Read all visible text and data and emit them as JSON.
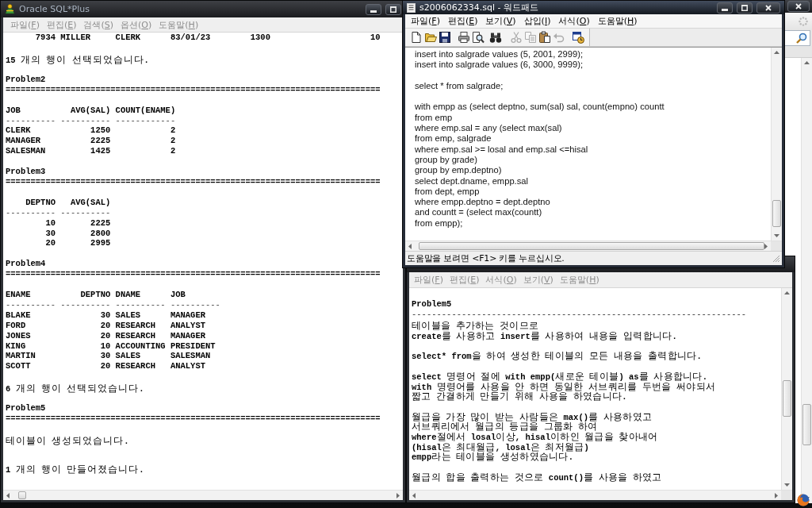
{
  "sqlplus_window": {
    "title": "Oracle SQL*Plus",
    "active": false,
    "menu": [
      "파일(F)",
      "편집(E)",
      "검색(S)",
      "옵션(O)",
      "도움말(H)"
    ],
    "sections": [
      {
        "lines": [
          "      7934 MILLER     CLERK      83/01/23        1300                    10"
        ],
        "blocks": [
          {
            "kind": "message",
            "text": "15 개의 행이 선택되었습니다."
          }
        ]
      },
      {
        "heading": "Problem2",
        "rule": "===========================================================================",
        "blocks": [
          {
            "kind": "table",
            "columns": [
              {
                "heading": "JOB",
                "rule": "----------",
                "kind": "text"
              },
              {
                "heading": "AVG(SAL)",
                "rule": "----------",
                "kind": "number"
              },
              {
                "heading": "COUNT(ENAME)",
                "rule": "------------",
                "kind": "number"
              }
            ],
            "rows": [
              [
                "CLERK",
                "1250",
                "2"
              ],
              [
                "MANAGER",
                "2225",
                "2"
              ],
              [
                "SALESMAN",
                "1425",
                "2"
              ]
            ]
          }
        ]
      },
      {
        "heading": "Problem3",
        "rule": "===========================================================================",
        "blocks": [
          {
            "kind": "table",
            "columns": [
              {
                "heading": "DEPTNO",
                "rule": "----------",
                "kind": "number"
              },
              {
                "heading": "AVG(SAL)",
                "rule": "----------",
                "kind": "number"
              }
            ],
            "rows": [
              [
                "10",
                "2225"
              ],
              [
                "30",
                "2800"
              ],
              [
                "20",
                "2995"
              ]
            ]
          }
        ]
      },
      {
        "heading": "Problem4",
        "rule": "===========================================================================",
        "blocks": [
          {
            "kind": "table",
            "columns": [
              {
                "heading": "ENAME",
                "rule": "----------",
                "kind": "text"
              },
              {
                "heading": "DEPTNO",
                "rule": "----------",
                "kind": "number"
              },
              {
                "heading": "DNAME",
                "rule": "----------",
                "kind": "text"
              },
              {
                "heading": "JOB",
                "rule": "----------",
                "kind": "text"
              }
            ],
            "rows": [
              [
                "BLAKE",
                "30",
                "SALES",
                "MANAGER"
              ],
              [
                "FORD",
                "20",
                "RESEARCH",
                "ANALYST"
              ],
              [
                "JONES",
                "20",
                "RESEARCH",
                "MANAGER"
              ],
              [
                "KING",
                "10",
                "ACCOUNTING",
                "PRESIDENT"
              ],
              [
                "MARTIN",
                "30",
                "SALES",
                "SALESMAN"
              ],
              [
                "SCOTT",
                "20",
                "RESEARCH",
                "ANALYST"
              ]
            ]
          },
          {
            "kind": "message",
            "text": "6 개의 행이 선택되었습니다."
          }
        ]
      },
      {
        "heading": "Problem5",
        "rule": "===========================================================================",
        "blocks": [
          {
            "kind": "message",
            "text": "테이블이 생성되었습니다."
          },
          {
            "kind": "message",
            "text": "1 개의 행이 만들어졌습니다."
          }
        ]
      }
    ]
  },
  "notepad_window": {
    "active": false,
    "menu": [
      "파일(F)",
      "편집(E)",
      "서식(O)",
      "보기(V)",
      "도움말(H)"
    ],
    "heading": "Problem5",
    "rule": "-------------------------------------------------------------------",
    "paragraphs": [
      [
        "테이블을 추가하는 것이므로",
        "create를 사용하고 insert를 사용하여 내용을 입력합니다."
      ],
      [
        "select* from을 하여 생성한 테이블의 모든 내용을 출력합니다."
      ],
      [
        "select 명령어 절에 with empp(새로운 테이블) as를 사용합니다.",
        "with 명령어를 사용을 안 하면 동일한 서브쿼리를 두번을 써야되서",
        "짧고 간결하게 만들기 위해 사용을 하였습니다."
      ],
      [
        "월급을 가장 많이 받는 사람들은 max()를 사용하였고",
        "서브쿼리에서 월급의 등급을 그룹화 하여",
        "where절에서 losal이상, hisal이하인 월급을 찾아내어",
        "(hisal은 최대월급, losal은 최저월급)",
        "empp라는 테이블을 생성하였습니다."
      ],
      [
        "월급의 합을 출력하는 것으로 count()를 사용을 하였고"
      ]
    ]
  },
  "wordpad_window": {
    "title": "s2006062334.sql - 워드패드",
    "active": true,
    "menu": [
      "파일(F)",
      "편집(E)",
      "보기(V)",
      "삽입(I)",
      "서식(O)",
      "도움말(H)"
    ],
    "toolbar": [
      {
        "disabled": false
      },
      {
        "disabled": false
      },
      {
        "disabled": false
      },
      {
        "disabled": false
      },
      {
        "disabled": false
      },
      {
        "disabled": false
      },
      {
        "disabled": true
      },
      {
        "disabled": true
      },
      {
        "disabled": false
      },
      {
        "disabled": true
      },
      {
        "disabled": false
      }
    ],
    "paragraphs": [
      [
        "insert into salgrade values (5, 2001, 2999);",
        "insert into salgrade values (6, 3000, 9999);"
      ],
      [
        "select * from salgrade;"
      ],
      [
        "with empp as (select deptno, sum(sal) sal, count(empno) countt",
        "from emp",
        "where emp.sal = any (select max(sal)",
        "from emp, salgrade",
        "where emp.sal >= losal and emp.sal <=hisal",
        "group by grade)",
        "group by emp.deptno)",
        "select dept.dname, empp.sal",
        "from dept, empp",
        "where empp.deptno = dept.deptno",
        "and countt = (select max(countt)",
        "from empp);"
      ]
    ],
    "status_bar": "도움말을 보려면 <F1> 키를 누르십시오."
  }
}
